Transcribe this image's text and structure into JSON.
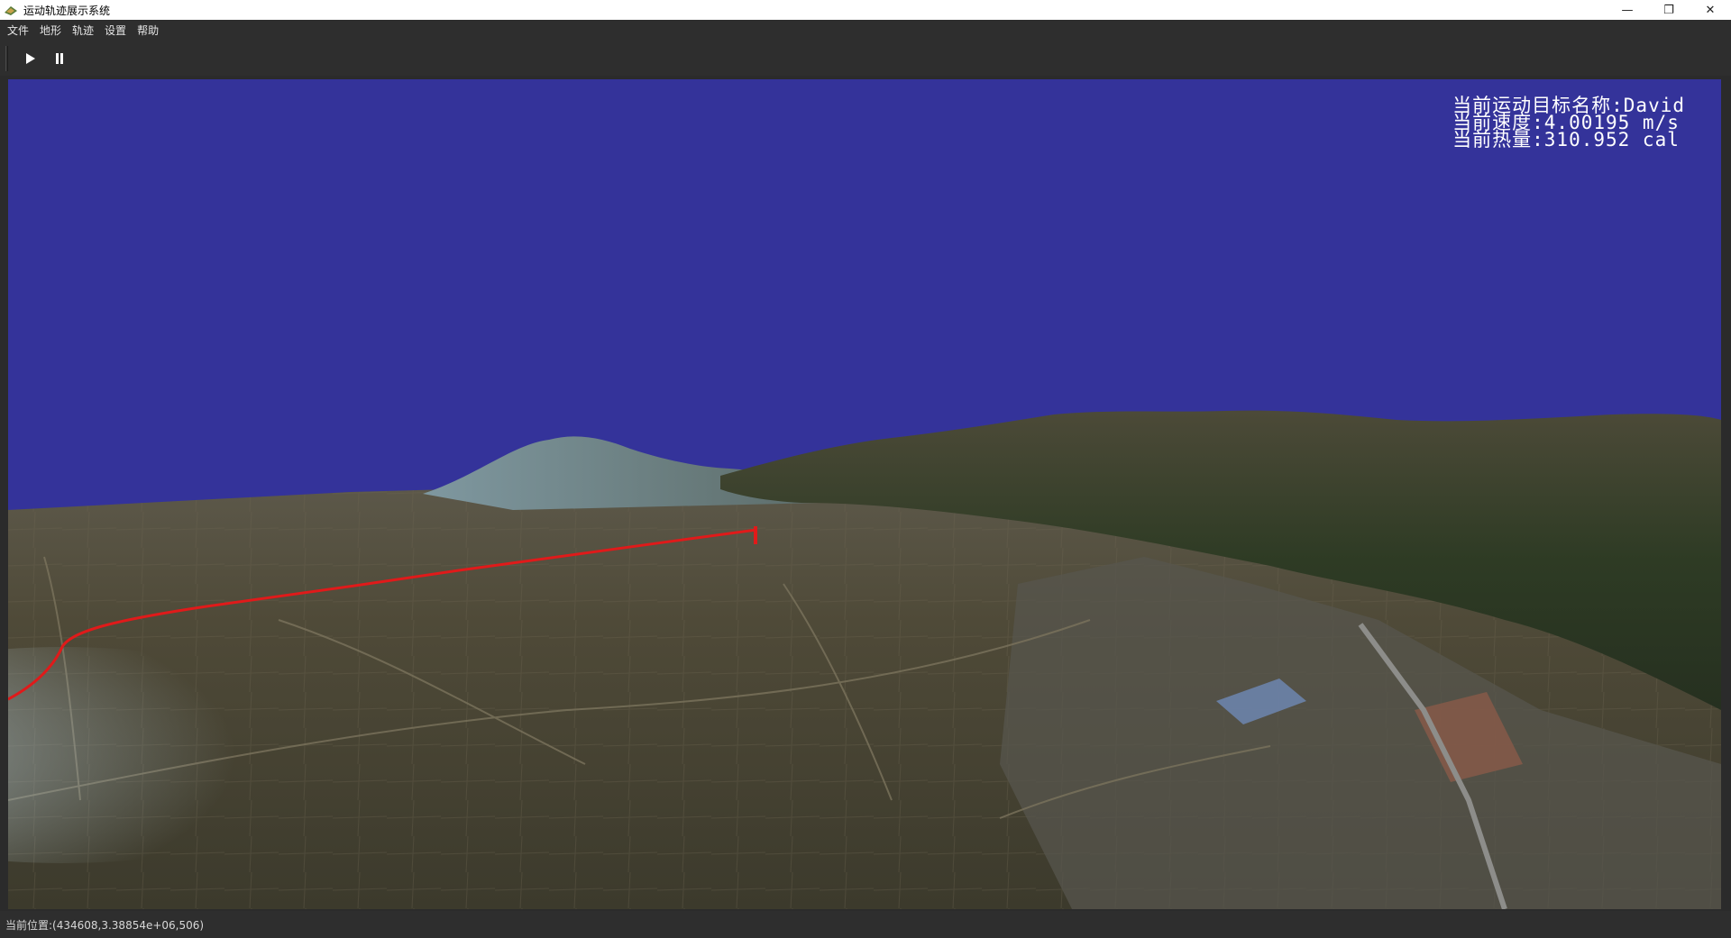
{
  "window": {
    "title": "运动轨迹展示系统",
    "app_icon": "app-icon",
    "controls": {
      "minimize": "—",
      "maximize": "❐",
      "close": "✕"
    }
  },
  "menubar": {
    "items": [
      {
        "label": "文件"
      },
      {
        "label": "地形"
      },
      {
        "label": "轨迹"
      },
      {
        "label": "设置"
      },
      {
        "label": "帮助"
      }
    ]
  },
  "toolbar": {
    "buttons": [
      {
        "name": "play-icon"
      },
      {
        "name": "pause-icon"
      }
    ]
  },
  "viewport": {
    "sky_color": "#34339a",
    "track_color": "#e01a1a",
    "hud": {
      "target_name": "当前运动目标名称:David",
      "speed": "当前速度:4.00195 m/s",
      "calories": "当前热量:310.952 cal"
    }
  },
  "statusbar": {
    "position_text": "当前位置:(434608,3.38854e+06,506)"
  }
}
